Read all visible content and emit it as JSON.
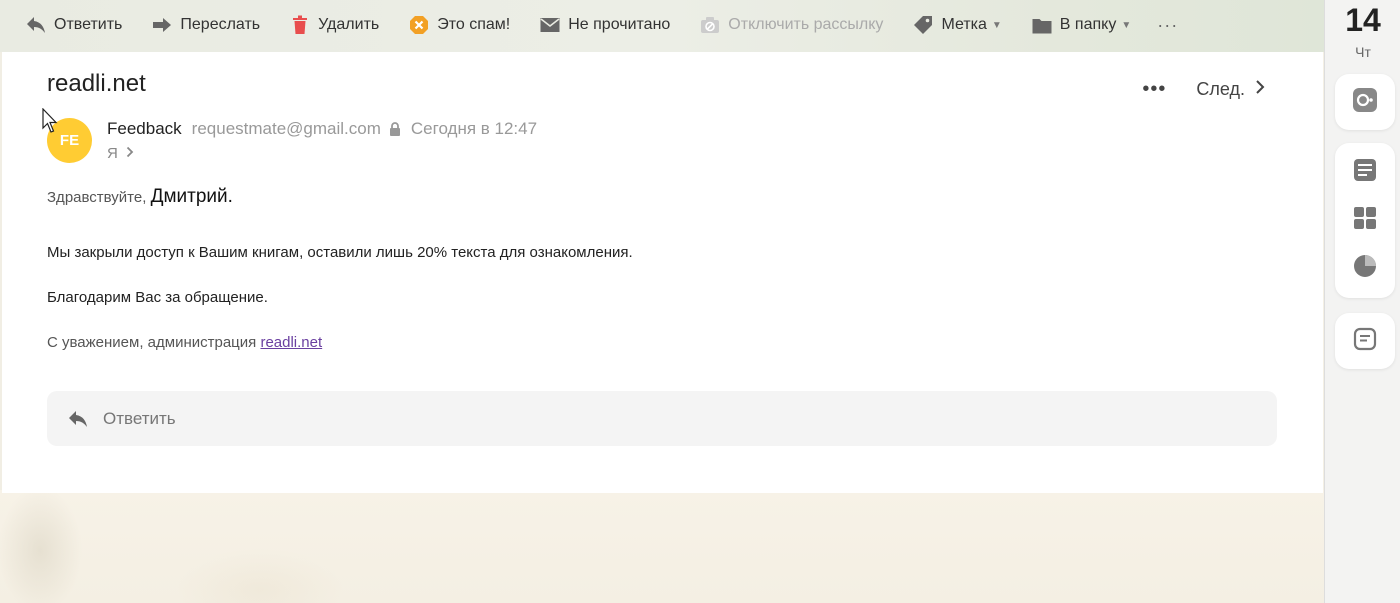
{
  "toolbar": {
    "items": [
      {
        "label": "Ответить",
        "icon": "reply-icon"
      },
      {
        "label": "Переслать",
        "icon": "forward-icon"
      },
      {
        "label": "Удалить",
        "icon": "trash-icon"
      },
      {
        "label": "Это спам!",
        "icon": "spam-icon"
      },
      {
        "label": "Не прочитано",
        "icon": "envelope-icon"
      },
      {
        "label": "Отключить рассылку",
        "icon": "unsubscribe-icon",
        "disabled": true
      },
      {
        "label": "Метка",
        "icon": "tag-icon"
      },
      {
        "label": "В папку",
        "icon": "folder-icon"
      }
    ],
    "more": "···"
  },
  "letter": {
    "subject": "readli.net",
    "next_label": "След.",
    "avatar_initials": "FE",
    "sender_name": "Feedback",
    "sender_email": "requestmate@gmail.com",
    "date": "Сегодня в 12:47",
    "recipient": "Я",
    "greeting_prefix": "Здравствуйте,",
    "greeting_name": "Дмитрий.",
    "paragraph1": "Мы закрыли доступ к Вашим книгам, оставили лишь 20% текста для ознакомления.",
    "paragraph2": "Благодарим Вас за обращение.",
    "signature_prefix": "С уважением, администрация",
    "signature_link": "readli.net",
    "reply_placeholder": "Ответить"
  },
  "rail": {
    "day": "14",
    "weekday": "Чт"
  },
  "colors": {
    "avatar": "#ffcc33",
    "spam": "#f2a024",
    "trash": "#e84d4d",
    "link": "#6a3fa0"
  }
}
